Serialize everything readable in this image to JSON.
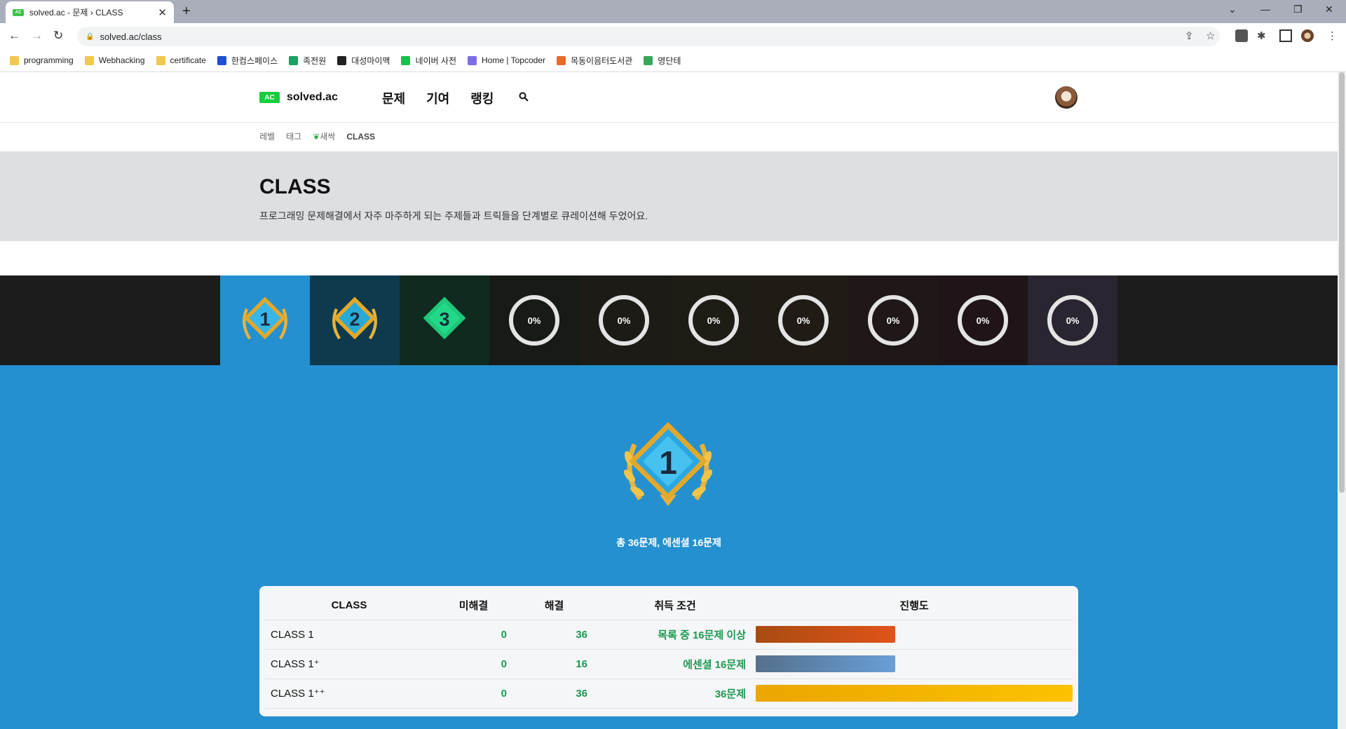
{
  "browser": {
    "tab_title": "solved.ac - 문제 › CLASS",
    "url": "solved.ac/class",
    "bookmarks": [
      {
        "label": "programming",
        "color": "#f2c94c"
      },
      {
        "label": "Webhacking",
        "color": "#f2c94c"
      },
      {
        "label": "certificate",
        "color": "#f2c94c"
      },
      {
        "label": "한컴스페이스",
        "color": "#1f4fd1"
      },
      {
        "label": "족전원",
        "color": "#1aa260"
      },
      {
        "label": "대성마이맥",
        "color": "#222222"
      },
      {
        "label": "네이버 사전",
        "color": "#19c150"
      },
      {
        "label": "Home | Topcoder",
        "color": "#7c6ee6"
      },
      {
        "label": "목동이음터도서관",
        "color": "#e86a2a"
      },
      {
        "label": "영단테",
        "color": "#3aa55b"
      }
    ]
  },
  "site": {
    "logo_badge": "AC",
    "logo_text": "solved.ac",
    "menu": [
      "문제",
      "기여",
      "랭킹"
    ],
    "subnav": [
      "레벨",
      "태그",
      "새싹",
      "CLASS"
    ]
  },
  "hero": {
    "title": "CLASS",
    "description": "프로그래밍 문제해결에서 자주 마주하게 되는 주제들과 트릭들을 단계별로 큐레이션해 두었어요."
  },
  "classes": [
    {
      "label": "1"
    },
    {
      "label": "2"
    },
    {
      "label": "3"
    },
    {
      "label": "0%"
    },
    {
      "label": "0%"
    },
    {
      "label": "0%"
    },
    {
      "label": "0%"
    },
    {
      "label": "0%"
    },
    {
      "label": "0%"
    },
    {
      "label": "0%"
    }
  ],
  "detail": {
    "badge_number": "1",
    "summary": "총 36문제, 에센셜 16문제"
  },
  "table": {
    "headers": [
      "CLASS",
      "미해결",
      "해결",
      "취득 조건",
      "진행도"
    ],
    "rows": [
      {
        "name": "CLASS 1",
        "unsolved": "0",
        "solved": "36",
        "condition": "목록 중 16문제 이상",
        "progress": 0.44
      },
      {
        "name": "CLASS 1⁺",
        "unsolved": "0",
        "solved": "16",
        "condition": "에센셜 16문제",
        "progress": 0.44
      },
      {
        "name": "CLASS 1⁺⁺",
        "unsolved": "0",
        "solved": "36",
        "condition": "36문제",
        "progress": 1.0
      }
    ]
  },
  "colors": {
    "accent": "#2490cf",
    "green": "#1b9a52",
    "bar1": "#e0541a",
    "bar2": "#6a9fd8",
    "bar3": "#fcc200"
  }
}
